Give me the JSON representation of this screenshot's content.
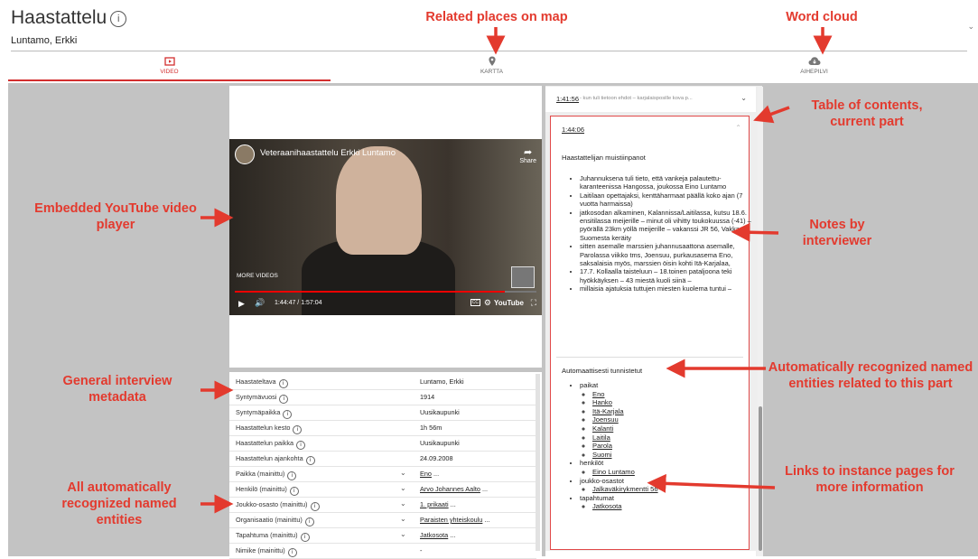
{
  "header": {
    "title": "Haastattelu",
    "subtitle": "Luntamo, Erkki"
  },
  "tabs": [
    {
      "label": "VIDEO",
      "active": true,
      "icon": "video-icon"
    },
    {
      "label": "KARTTA",
      "active": false,
      "icon": "map-pin-icon"
    },
    {
      "label": "AIHEPILVI",
      "active": false,
      "icon": "cloud-icon"
    }
  ],
  "video": {
    "title": "Veteraanihaastattelu Erkki Luntamo",
    "share_label": "Share",
    "more_videos": "MORE VIDEOS",
    "time": "1:44:47 / 1:57:04",
    "cc": "CC",
    "brand": "YouTube",
    "progress_fraction": 0.895
  },
  "metadata": [
    {
      "key": "Haastateltava",
      "value": "Luntamo, Erkki",
      "link": false,
      "expand": false
    },
    {
      "key": "Syntymävuosi",
      "value": "1914",
      "link": false,
      "expand": false
    },
    {
      "key": "Syntymäpaikka",
      "value": "Uusikaupunki",
      "link": false,
      "expand": false
    },
    {
      "key": "Haastattelun kesto",
      "value": "1h 56m",
      "link": false,
      "expand": false
    },
    {
      "key": "Haastattelun paikka",
      "value": "Uusikaupunki",
      "link": false,
      "expand": false
    },
    {
      "key": "Haastattelun ajankohta",
      "value": "24.09.2008",
      "link": false,
      "expand": false
    },
    {
      "key": "Paikka (mainittu)",
      "value": "Eno",
      "suffix": " ...",
      "link": true,
      "expand": true
    },
    {
      "key": "Henkilö (mainittu)",
      "value": "Arvo Johannes Aalto",
      "suffix": " ...",
      "link": true,
      "expand": true
    },
    {
      "key": "Joukko-osasto (mainittu)",
      "value": "1. prikaati",
      "suffix": " ...",
      "link": true,
      "expand": true
    },
    {
      "key": "Organisaatio (mainittu)",
      "value": "Paraisten yhteiskoulu",
      "suffix": " ...",
      "link": true,
      "expand": true
    },
    {
      "key": "Tapahtuma (mainittu)",
      "value": "Jatkosota",
      "suffix": " ...",
      "link": true,
      "expand": true
    },
    {
      "key": "Nimike (mainittu)",
      "value": "-",
      "link": false,
      "expand": false
    }
  ],
  "toc": {
    "prev": {
      "time": "1:41:56",
      "text": "- kun tuli tietoon ehdot – karjalaisposille kova p..."
    },
    "current": {
      "time": "1:44:06",
      "notes_heading": "Haastattelijan muistiinpanot",
      "notes": [
        "Juhannuksena tuli tieto, että vankeja palautettu- karanteenissa Hangossa, joukossa Eino Luntamo",
        "Laitilaan opettajaksi, kenttäharmaat päällä koko ajan (7 vuotta harmaissa)",
        "jatkosodan alkaminen, Kalannissa/Laitilassa, kutsu 18.6. ensitilassa meijerille – minut oli vihitty toukokuussa (-41) – pyörällä 23km yöllä meijerille – vakanssi JR 56, Vakka - Suomesta keräity",
        "sitten asemalle marssien juhannusaattona asemalle, Parolassa viikko tms, Joensuu, purkausasema Eno, saksalaisia myös, marssien öisin kohti Itä-Karjalaa,",
        "17.7. Kollaalla taisteluun – 18.toinen pataljoona teki hyökkäyksen – 43 miestä kuoli siinä –",
        "millaisia ajatuksia tuttujen miesten kuolema tuntui –"
      ],
      "entities_heading": "Automaattisesti tunnistetut",
      "entities": [
        {
          "type": "paikat",
          "items": [
            "Eno",
            "Hanko",
            "Itä-Karjala",
            "Joensuu",
            "Kalanti",
            "Laitila",
            "Parola",
            "Suomi"
          ]
        },
        {
          "type": "henkilöt",
          "items": [
            "Eino Luntamo"
          ]
        },
        {
          "type": "joukko-osastot",
          "items": [
            "Jalkaväkirykmentti 56"
          ]
        },
        {
          "type": "tapahtumat",
          "items": [
            "Jatkosota"
          ]
        }
      ]
    }
  },
  "annotations": {
    "map": "Related places on map",
    "cloud": "Word cloud",
    "toc": "Table of contents, current part",
    "video": "Embedded YouTube video player",
    "notes": "Notes by interviewer",
    "meta": "General interview metadata",
    "auto": "Automatically recognized named entities related to this part",
    "all": "All automatically recognized named entities",
    "links": "Links to instance pages for more information"
  },
  "colors": {
    "accent": "#d32f2f",
    "annotation": "#e33a2e",
    "background": "#c3c3c3"
  }
}
